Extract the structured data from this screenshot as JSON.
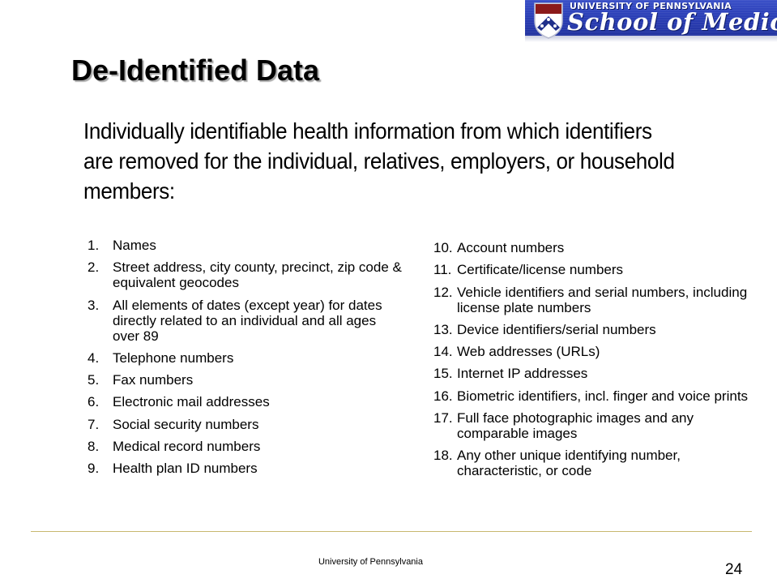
{
  "header": {
    "logo": {
      "icon": "penn-shield-icon",
      "university": "UNIVERSITY OF PENNSYLVANIA",
      "school": "School of Medicine",
      "colors": {
        "banner": "#2b3fb6",
        "shield_top": "#8b1a1a",
        "shield_chevron": "#1f2f8a"
      }
    }
  },
  "slide": {
    "title": "De-Identified Data",
    "intro": "Individually identifiable health information from which identifiers are removed for the individual, relatives, employers, or household members:",
    "identifiers_left": [
      {
        "num": "1.",
        "text": "Names"
      },
      {
        "num": "2.",
        "text": "Street address, city county, precinct, zip code & equivalent geocodes"
      },
      {
        "num": "3.",
        "text": "All elements of dates (except year) for dates directly related to an individual and all ages over 89"
      },
      {
        "num": "4.",
        "text": "Telephone numbers"
      },
      {
        "num": "5.",
        "text": "Fax numbers"
      },
      {
        "num": "6.",
        "text": "Electronic mail addresses"
      },
      {
        "num": "7.",
        "text": "Social security numbers"
      },
      {
        "num": "8.",
        "text": "Medical record numbers"
      },
      {
        "num": "9.",
        "text": "Health plan ID numbers"
      }
    ],
    "identifiers_right": [
      {
        "num": "10.",
        "text": "Account numbers"
      },
      {
        "num": "11.",
        "text": "Certificate/license numbers"
      },
      {
        "num": "12.",
        "text": "Vehicle identifiers and serial numbers, including license plate numbers"
      },
      {
        "num": "13.",
        "text": "Device identifiers/serial numbers"
      },
      {
        "num": "14.",
        "text": "Web addresses (URLs)"
      },
      {
        "num": "15.",
        "text": "Internet IP addresses"
      },
      {
        "num": "16.",
        "text": "Biometric identifiers, incl. finger and voice prints"
      },
      {
        "num": "17.",
        "text": "Full face photographic images and any comparable images"
      },
      {
        "num": "18.",
        "text": "Any other unique identifying number, characteristic, or code"
      }
    ]
  },
  "footer": {
    "organization": "University of Pennsylvania",
    "page_number": "24",
    "rule_color": "#c8b870"
  }
}
